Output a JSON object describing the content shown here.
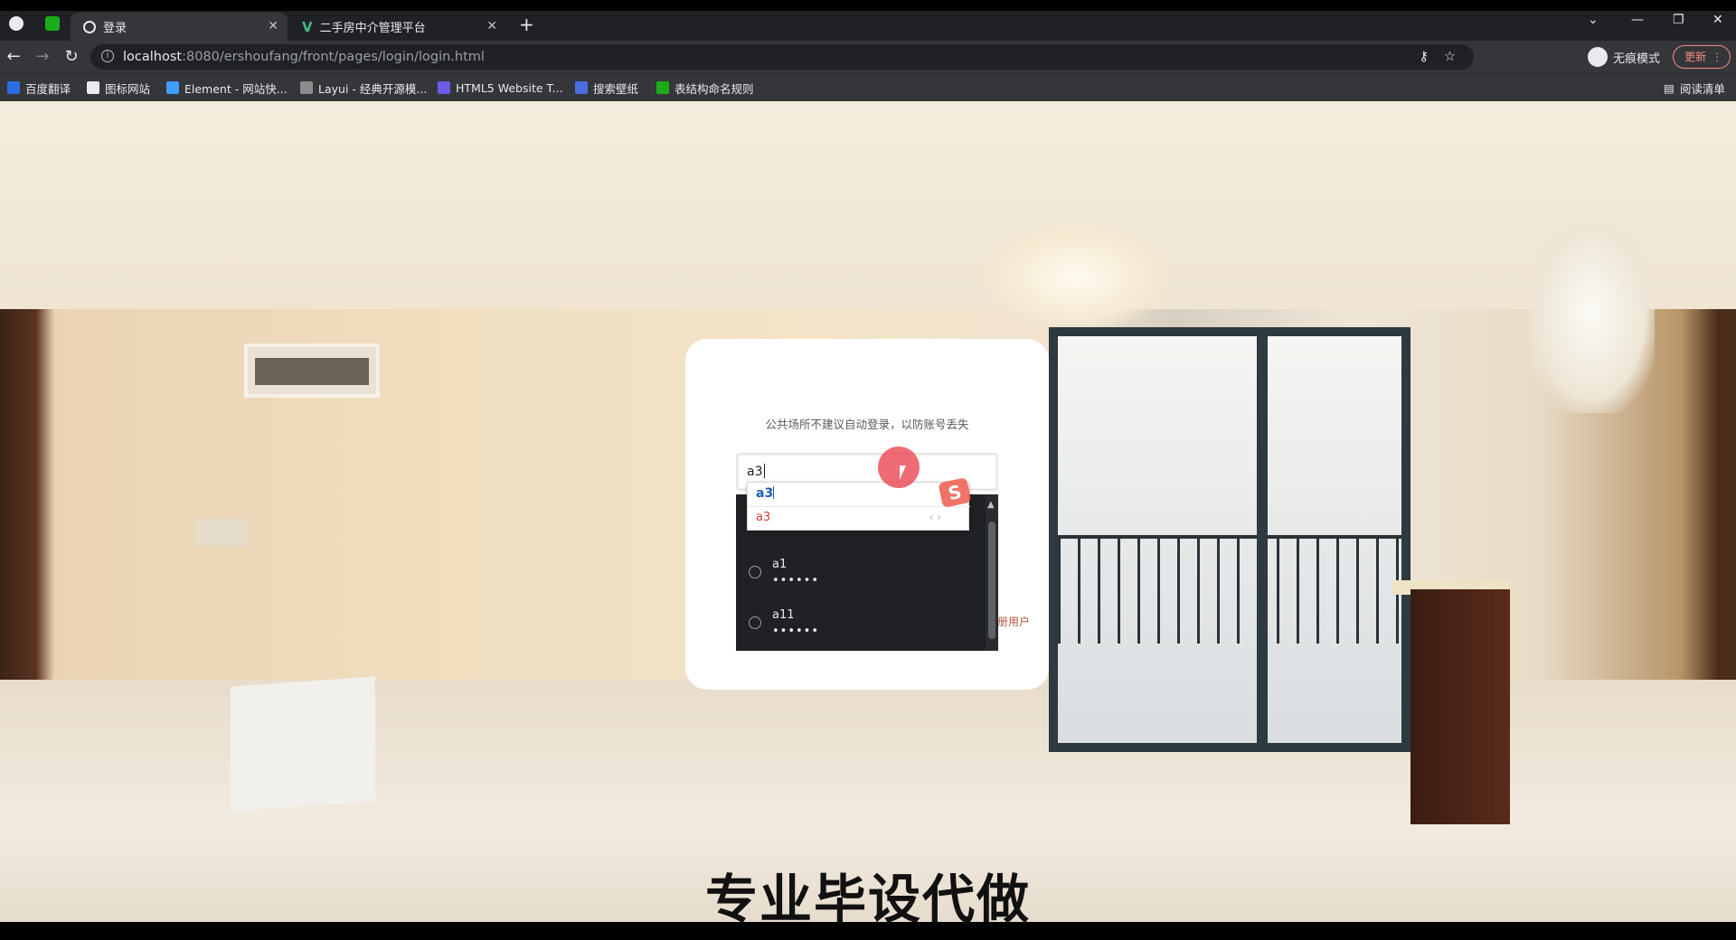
{
  "browser": {
    "tabs": [
      {
        "title": "登录",
        "active": true
      },
      {
        "title": "二手房中介管理平台",
        "active": false
      }
    ],
    "url_host": "localhost",
    "url_path": ":8080/ershoufang/front/pages/login/login.html",
    "incognito_label": "无痕模式",
    "update_label": "更新",
    "reading_list_label": "阅读清单",
    "bookmarks": [
      {
        "label": "百度翻译",
        "color": "#2b6fe0"
      },
      {
        "label": "图标网站",
        "color": "#e8eaed"
      },
      {
        "label": "Element - 网站快...",
        "color": "#409eff"
      },
      {
        "label": "Layui - 经典开源模...",
        "color": "#e8eaed"
      },
      {
        "label": "HTML5 Website T...",
        "color": "#6c5ce7"
      },
      {
        "label": "搜索壁纸",
        "color": "#4a6ee0"
      },
      {
        "label": "表结构命名规则",
        "color": "#1aad19"
      }
    ]
  },
  "login": {
    "tip": "公共场所不建议自动登录，以防账号丢失",
    "username_value": "a3",
    "register_link": "册用户"
  },
  "autocomplete": {
    "items": [
      {
        "user": "",
        "password": "•••"
      },
      {
        "user": "a1",
        "password": "••••••"
      },
      {
        "user": "a11",
        "password": "••••••"
      }
    ]
  },
  "ime": {
    "composition": "a3",
    "candidate": "a3",
    "logo": "S"
  },
  "overlay_caption": "专业毕设代做",
  "colors": {
    "chrome_dark": "#202124",
    "chrome_mid": "#35363a",
    "accent_register": "#b0563e",
    "cursor_highlight": "#e93a48"
  }
}
